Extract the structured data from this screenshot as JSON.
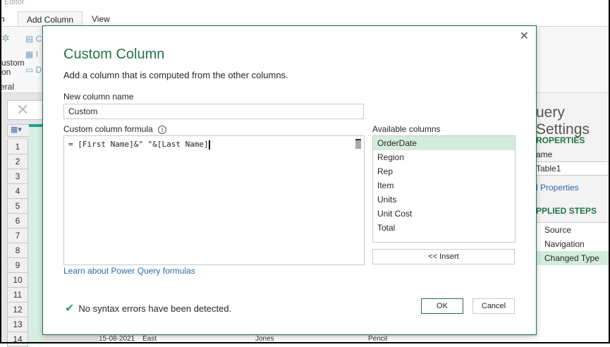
{
  "app": {
    "title": "Editor"
  },
  "ribbon": {
    "tabs": [
      {
        "label": "n"
      },
      {
        "label": "Add Column"
      },
      {
        "label": "View"
      }
    ],
    "custom_label_1": "ustom",
    "custom_label_2": "on",
    "group_label": "eral",
    "small_items": [
      "C",
      "I",
      "D"
    ]
  },
  "grid": {
    "row_numbers": [
      "1",
      "2",
      "3",
      "4",
      "5",
      "6",
      "7",
      "8",
      "9",
      "10",
      "11",
      "12",
      "13",
      "14"
    ],
    "partial_row": [
      "15-08-2021",
      "East",
      "Jones",
      "Pencil"
    ]
  },
  "query_settings": {
    "title": "uery Settings",
    "properties_header": "ROPERTIES",
    "name_label": "ame",
    "name_value": "Table1",
    "all_properties": "l Properties",
    "applied_steps_header": "PPLIED STEPS",
    "steps": [
      {
        "label": "Source"
      },
      {
        "label": "Navigation"
      },
      {
        "label": "Changed Type"
      }
    ]
  },
  "dialog": {
    "title": "Custom Column",
    "subtitle": "Add a column that is computed from the other columns.",
    "name_label": "New column name",
    "name_value": "Custom",
    "formula_label": "Custom column formula",
    "formula": "= [First Name]&\" \"&[Last Name]",
    "available_label": "Available columns",
    "columns": [
      "OrderDate",
      "Region",
      "Rep",
      "Item",
      "Units",
      "Unit Cost",
      "Total"
    ],
    "insert_label": "<< Insert",
    "learn_link": "Learn about Power Query formulas",
    "status": "No syntax errors have been detected.",
    "ok_label": "OK",
    "cancel_label": "Cancel",
    "accent": "#217346"
  }
}
